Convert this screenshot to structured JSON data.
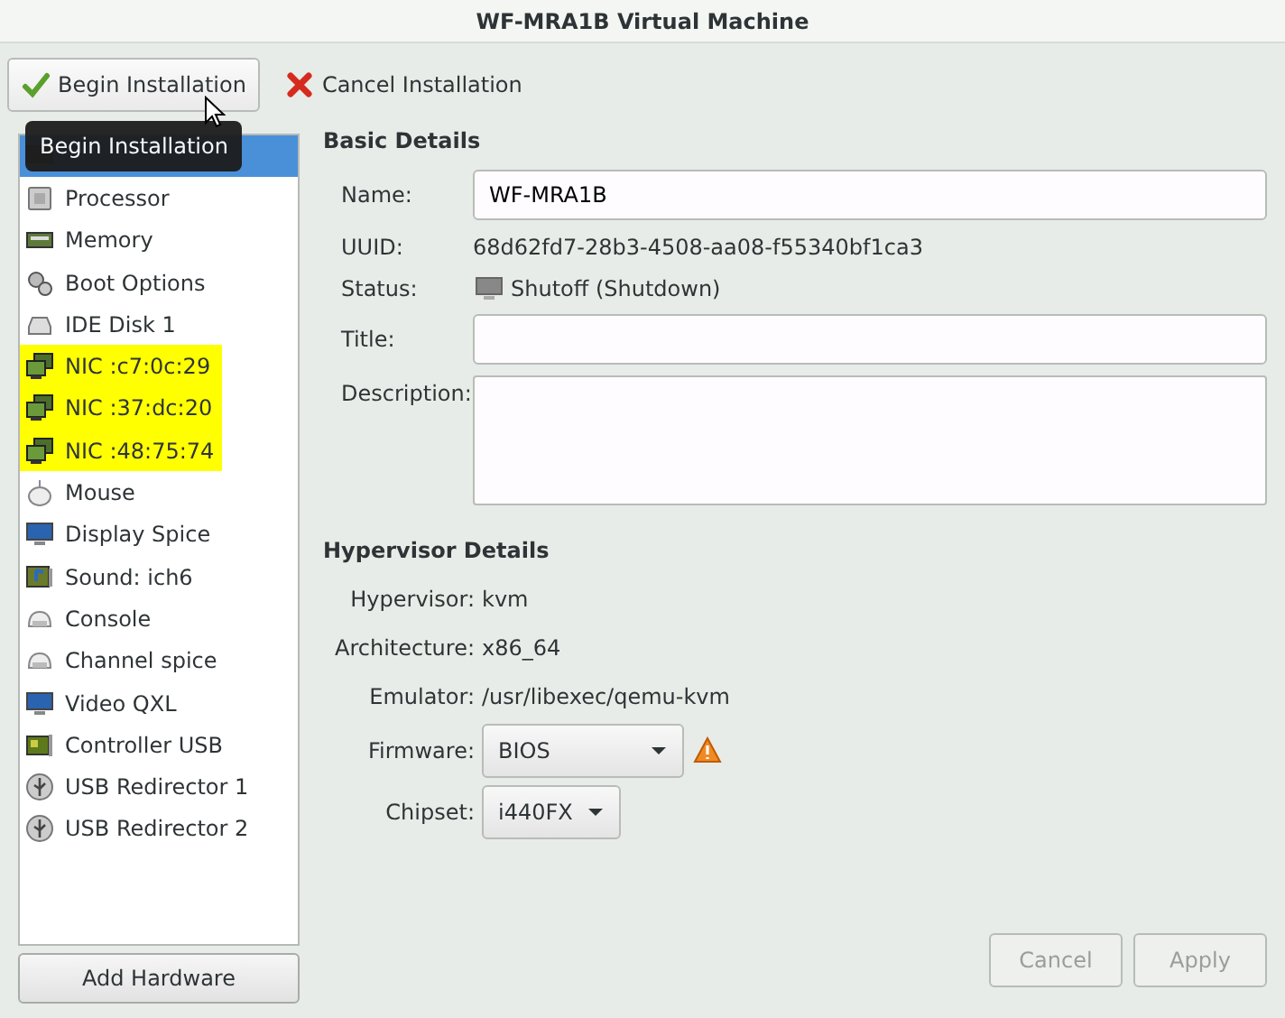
{
  "window": {
    "title": "WF-MRA1B Virtual Machine"
  },
  "toolbar": [
    {
      "kind": "begin",
      "label": "Begin Installation",
      "hovered": true
    },
    {
      "kind": "cancel",
      "label": "Cancel Installation",
      "hovered": false
    }
  ],
  "tooltip": {
    "text": "Begin Installation"
  },
  "hardware_list": [
    {
      "kind": "overview",
      "selected": true,
      "highlighted": false
    },
    {
      "kind": "cpu",
      "label": "Processor",
      "selected": false,
      "highlighted": false
    },
    {
      "kind": "memory",
      "label": "Memory",
      "selected": false,
      "highlighted": false
    },
    {
      "kind": "boot",
      "label": "Boot Options",
      "selected": false,
      "highlighted": false
    },
    {
      "kind": "disk",
      "label": "IDE Disk 1",
      "selected": false,
      "highlighted": false
    },
    {
      "kind": "nic",
      "label": "NIC :c7:0c:29",
      "selected": false,
      "highlighted": true
    },
    {
      "kind": "nic",
      "label": "NIC :37:dc:20",
      "selected": false,
      "highlighted": true
    },
    {
      "kind": "nic",
      "label": "NIC :48:75:74",
      "selected": false,
      "highlighted": true
    },
    {
      "kind": "mouse",
      "label": "Mouse",
      "selected": false,
      "highlighted": false
    },
    {
      "kind": "display",
      "label": "Display Spice",
      "selected": false,
      "highlighted": false
    },
    {
      "kind": "sound",
      "label": "Sound: ich6",
      "selected": false,
      "highlighted": false
    },
    {
      "kind": "serial",
      "label": "Console",
      "selected": false,
      "highlighted": false
    },
    {
      "kind": "serial",
      "label": "Channel spice",
      "selected": false,
      "highlighted": false
    },
    {
      "kind": "display",
      "label": "Video QXL",
      "selected": false,
      "highlighted": false
    },
    {
      "kind": "card",
      "label": "Controller USB",
      "selected": false,
      "highlighted": false
    },
    {
      "kind": "usb",
      "label": "USB Redirector 1",
      "selected": false,
      "highlighted": false
    },
    {
      "kind": "usb",
      "label": "USB Redirector 2",
      "selected": false,
      "highlighted": false
    }
  ],
  "add_hardware_button": "Add Hardware",
  "basic_details": {
    "heading": "Basic Details",
    "fields": [
      {
        "kind": "entry",
        "label": "Name:",
        "value": "WF-MRA1B"
      },
      {
        "kind": "text",
        "label": "UUID:",
        "value": "68d62fd7-28b3-4508-aa08-f55340bf1ca3"
      },
      {
        "kind": "status",
        "label": "Status:",
        "value": "Shutoff (Shutdown)"
      },
      {
        "kind": "entry",
        "label": "Title:"
      },
      {
        "kind": "textarea",
        "label": "Description:"
      }
    ]
  },
  "hypervisor_details": {
    "heading": "Hypervisor Details",
    "fields": [
      {
        "kind": "text",
        "label": "Hypervisor:",
        "value": "kvm"
      },
      {
        "kind": "text",
        "label": "Architecture:",
        "value": "x86_64"
      },
      {
        "kind": "text",
        "label": "Emulator:",
        "value": "/usr/libexec/qemu-kvm"
      },
      {
        "kind": "combo",
        "label": "Firmware:",
        "value": "BIOS",
        "warning": true
      },
      {
        "kind": "combo",
        "label": "Chipset:",
        "value": "i440FX",
        "warning": false
      }
    ]
  },
  "footer_buttons": [
    {
      "label": "Cancel",
      "disabled": true
    },
    {
      "label": "Apply",
      "disabled": true
    }
  ]
}
